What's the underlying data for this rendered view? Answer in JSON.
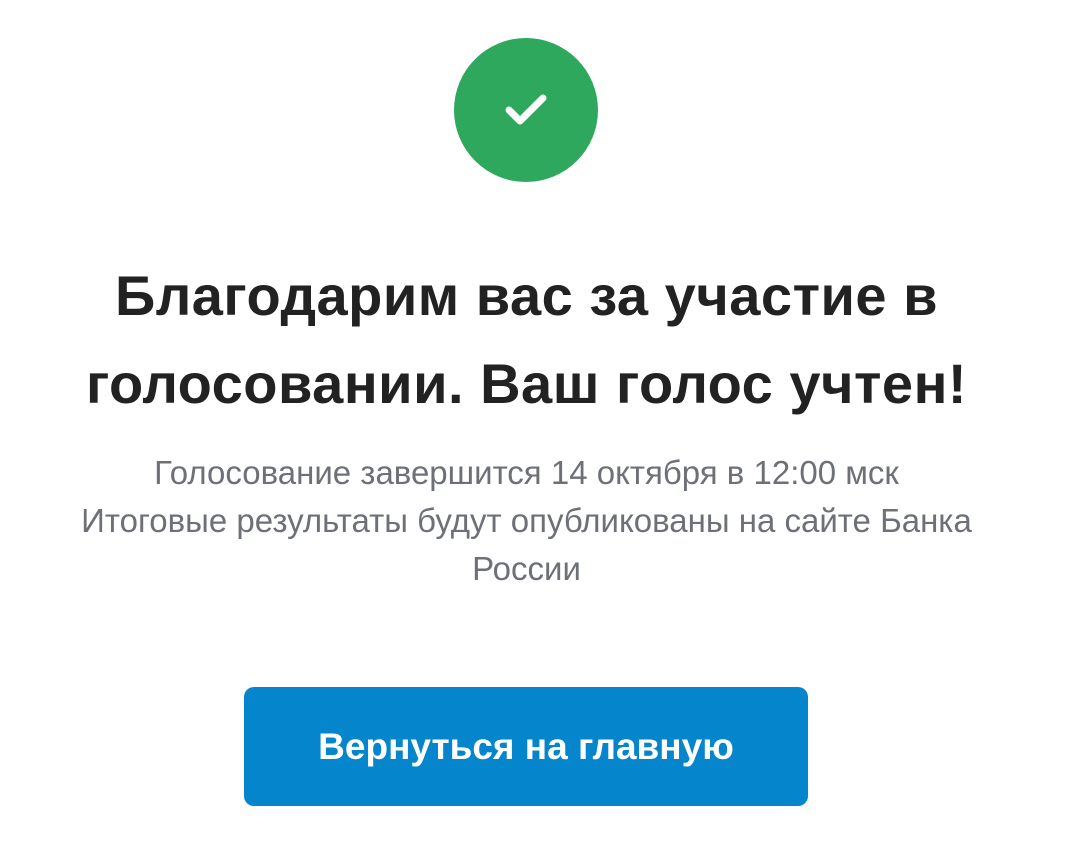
{
  "colors": {
    "success": "#2ea85c",
    "primary_button": "#0585cc",
    "title_text": "#222222",
    "info_text": "#6d7177"
  },
  "status_icon": "check-icon",
  "title": {
    "line1": "Благодарим вас за участие в",
    "line2": "голосовании. Ваш голос учтен!"
  },
  "info": {
    "line1": "Голосование завершится 14 октября в 12:00 мск",
    "line2": "Итоговые результаты будут опубликованы на сайте Банка",
    "line3": "России"
  },
  "home_button": {
    "label": "Вернуться на главную"
  }
}
